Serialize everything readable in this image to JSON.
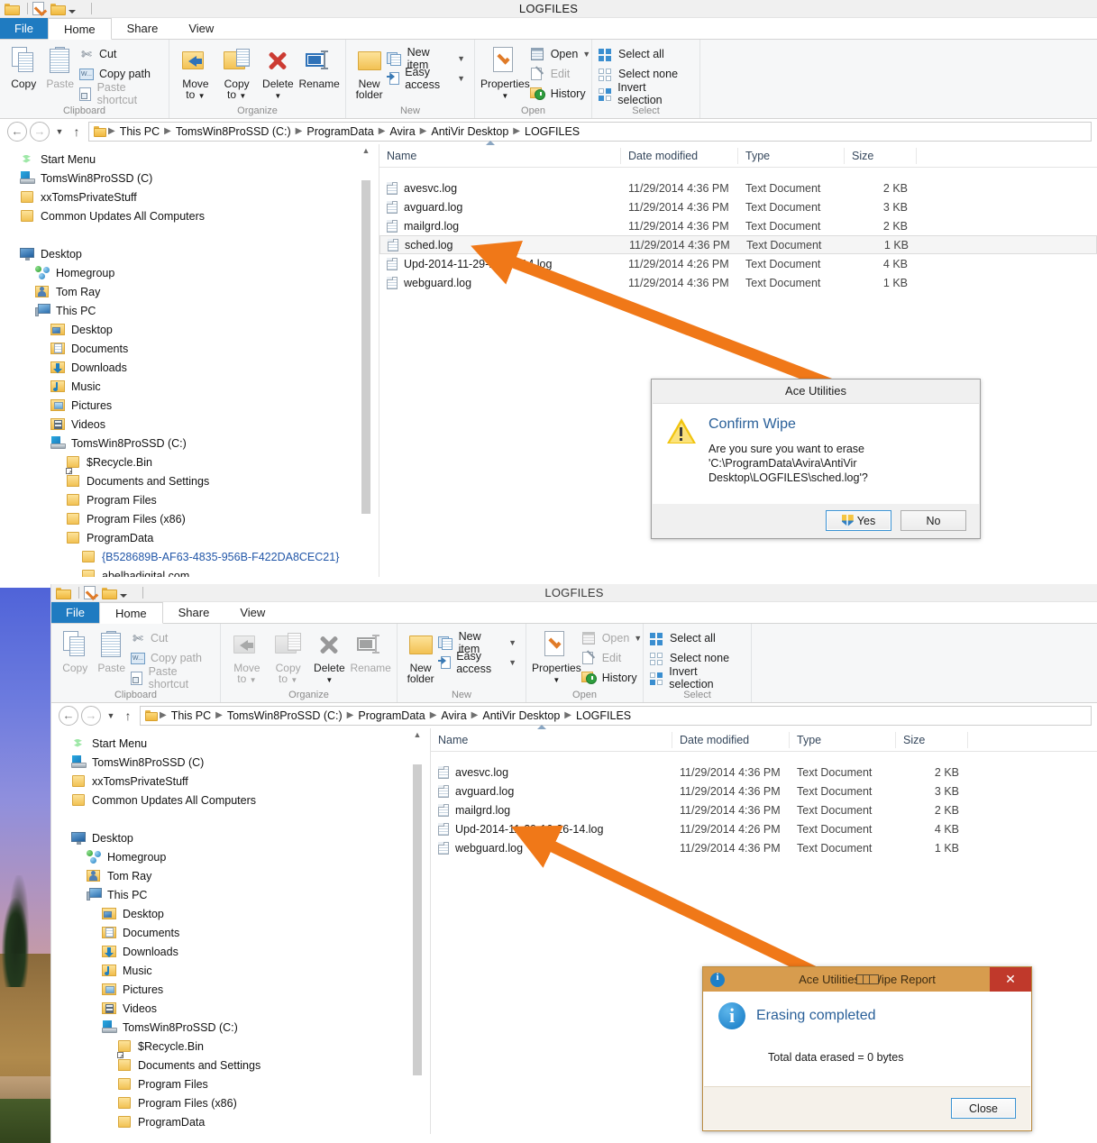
{
  "colors": {
    "accent_orange": "#F07818",
    "file_tab_blue": "#1F7BC1",
    "link_blue": "#2257A8",
    "dialog_title_blue": "#2A6099",
    "wipe_title_bar": "#D79C4E"
  },
  "window1": {
    "title": "LOGFILES",
    "tabs": [
      {
        "label": "File"
      },
      {
        "label": "Home"
      },
      {
        "label": "Share"
      },
      {
        "label": "View"
      }
    ],
    "ribbon": {
      "groups": [
        {
          "label": "Clipboard",
          "big": [
            {
              "label": "Copy",
              "icon": "copy-icon",
              "dim": false
            },
            {
              "label": "Paste",
              "icon": "paste-icon",
              "dim": true
            }
          ],
          "small": [
            {
              "label": "Cut",
              "icon": "scissors-icon",
              "dim": false
            },
            {
              "label": "Copy path",
              "icon": "copy-path-icon",
              "dim": false
            },
            {
              "label": "Paste shortcut",
              "icon": "paste-shortcut-icon",
              "dim": true
            }
          ]
        },
        {
          "label": "Organize",
          "big": [
            {
              "label": "Move to",
              "icon": "move-to-icon",
              "dim": false
            },
            {
              "label": "Copy to",
              "icon": "copy-to-icon",
              "dim": false
            },
            {
              "label": "Delete",
              "icon": "delete-icon",
              "dim": false
            },
            {
              "label": "Rename",
              "icon": "rename-icon",
              "dim": false
            }
          ],
          "small": []
        },
        {
          "label": "New",
          "big": [
            {
              "label": "New folder",
              "icon": "new-folder-icon",
              "dim": false
            }
          ],
          "small": [
            {
              "label": "New item",
              "icon": "new-item-icon",
              "dim": false,
              "dropdown": true
            },
            {
              "label": "Easy access",
              "icon": "easy-access-icon",
              "dim": false,
              "dropdown": true
            }
          ]
        },
        {
          "label": "Open",
          "big": [
            {
              "label": "Properties",
              "icon": "properties-icon",
              "dim": false
            }
          ],
          "small": [
            {
              "label": "Open",
              "icon": "open-icon",
              "dim": false,
              "dropdown": true
            },
            {
              "label": "Edit",
              "icon": "edit-icon",
              "dim": true
            },
            {
              "label": "History",
              "icon": "history-icon",
              "dim": false
            }
          ]
        },
        {
          "label": "Select",
          "big": [],
          "small": [
            {
              "label": "Select all",
              "icon": "select-all-icon",
              "dim": false
            },
            {
              "label": "Select none",
              "icon": "select-none-icon",
              "dim": false
            },
            {
              "label": "Invert selection",
              "icon": "invert-selection-icon",
              "dim": false
            }
          ]
        }
      ]
    },
    "breadcrumb": [
      "This PC",
      "TomsWin8ProSSD (C:)",
      "ProgramData",
      "Avira",
      "AntiVir Desktop",
      "LOGFILES"
    ],
    "nav_tree": [
      {
        "label": "Start Menu",
        "icon": "start-menu-icon",
        "indent": 0,
        "blue": false
      },
      {
        "label": "TomsWin8ProSSD (C)",
        "icon": "drive-icon",
        "indent": 0,
        "blue": false
      },
      {
        "label": "xxTomsPrivateStuff",
        "icon": "folder-icon",
        "indent": 0,
        "blue": false
      },
      {
        "label": "Common Updates All Computers",
        "icon": "folder-icon",
        "indent": 0,
        "blue": false
      },
      {
        "label": "",
        "icon": "spacer",
        "indent": 0,
        "blue": false
      },
      {
        "label": "Desktop",
        "icon": "desktop-icon",
        "indent": 0,
        "blue": false
      },
      {
        "label": "Homegroup",
        "icon": "homegroup-icon",
        "indent": 1,
        "blue": false
      },
      {
        "label": "Tom Ray",
        "icon": "user-folder-icon",
        "indent": 1,
        "blue": false
      },
      {
        "label": "This PC",
        "icon": "this-pc-icon",
        "indent": 1,
        "blue": false
      },
      {
        "label": "Desktop",
        "icon": "desktop-folder-icon",
        "indent": 2,
        "blue": false
      },
      {
        "label": "Documents",
        "icon": "documents-icon",
        "indent": 2,
        "blue": false
      },
      {
        "label": "Downloads",
        "icon": "downloads-icon",
        "indent": 2,
        "blue": false
      },
      {
        "label": "Music",
        "icon": "music-icon",
        "indent": 2,
        "blue": false
      },
      {
        "label": "Pictures",
        "icon": "pictures-icon",
        "indent": 2,
        "blue": false
      },
      {
        "label": "Videos",
        "icon": "videos-icon",
        "indent": 2,
        "blue": false
      },
      {
        "label": "TomsWin8ProSSD (C:)",
        "icon": "drive-icon",
        "indent": 2,
        "blue": false
      },
      {
        "label": "$Recycle.Bin",
        "icon": "folder-icon",
        "indent": 3,
        "blue": false
      },
      {
        "label": "Documents and Settings",
        "icon": "folder-link-icon",
        "indent": 3,
        "blue": false
      },
      {
        "label": "Program Files",
        "icon": "folder-icon",
        "indent": 3,
        "blue": false
      },
      {
        "label": "Program Files (x86)",
        "icon": "folder-icon",
        "indent": 3,
        "blue": false
      },
      {
        "label": "ProgramData",
        "icon": "folder-icon",
        "indent": 3,
        "blue": false
      },
      {
        "label": "{B528689B-AF63-4835-956B-F422DA8CEC21}",
        "icon": "folder-icon",
        "indent": 4,
        "blue": true
      },
      {
        "label": "abelhadigital.com",
        "icon": "folder-icon",
        "indent": 4,
        "blue": false
      }
    ],
    "columns": [
      "Name",
      "Date modified",
      "Type",
      "Size"
    ],
    "files": [
      {
        "name": "avesvc.log",
        "date": "11/29/2014 4:36 PM",
        "type": "Text Document",
        "size": "2 KB",
        "selected": false
      },
      {
        "name": "avguard.log",
        "date": "11/29/2014 4:36 PM",
        "type": "Text Document",
        "size": "3 KB",
        "selected": false
      },
      {
        "name": "mailgrd.log",
        "date": "11/29/2014 4:36 PM",
        "type": "Text Document",
        "size": "2 KB",
        "selected": false
      },
      {
        "name": "sched.log",
        "date": "11/29/2014 4:36 PM",
        "type": "Text Document",
        "size": "1 KB",
        "selected": true
      },
      {
        "name": "Upd-2014-11-29-16-26-14.log",
        "date": "11/29/2014 4:26 PM",
        "type": "Text Document",
        "size": "4 KB",
        "selected": false
      },
      {
        "name": "webguard.log",
        "date": "11/29/2014 4:36 PM",
        "type": "Text Document",
        "size": "1 KB",
        "selected": false
      }
    ]
  },
  "window2": {
    "title": "LOGFILES",
    "tabs": [
      {
        "label": "File"
      },
      {
        "label": "Home"
      },
      {
        "label": "Share"
      },
      {
        "label": "View"
      }
    ],
    "breadcrumb": [
      "This PC",
      "TomsWin8ProSSD (C:)",
      "ProgramData",
      "Avira",
      "AntiVir Desktop",
      "LOGFILES"
    ],
    "nav_tree": [
      {
        "label": "Start Menu",
        "icon": "start-menu-icon",
        "indent": 0,
        "blue": false
      },
      {
        "label": "TomsWin8ProSSD (C)",
        "icon": "drive-icon",
        "indent": 0,
        "blue": false
      },
      {
        "label": "xxTomsPrivateStuff",
        "icon": "folder-icon",
        "indent": 0,
        "blue": false
      },
      {
        "label": "Common Updates All Computers",
        "icon": "folder-icon",
        "indent": 0,
        "blue": false
      },
      {
        "label": "",
        "icon": "spacer",
        "indent": 0,
        "blue": false
      },
      {
        "label": "Desktop",
        "icon": "desktop-icon",
        "indent": 0,
        "blue": false
      },
      {
        "label": "Homegroup",
        "icon": "homegroup-icon",
        "indent": 1,
        "blue": false
      },
      {
        "label": "Tom Ray",
        "icon": "user-folder-icon",
        "indent": 1,
        "blue": false
      },
      {
        "label": "This PC",
        "icon": "this-pc-icon",
        "indent": 1,
        "blue": false
      },
      {
        "label": "Desktop",
        "icon": "desktop-folder-icon",
        "indent": 2,
        "blue": false
      },
      {
        "label": "Documents",
        "icon": "documents-icon",
        "indent": 2,
        "blue": false
      },
      {
        "label": "Downloads",
        "icon": "downloads-icon",
        "indent": 2,
        "blue": false
      },
      {
        "label": "Music",
        "icon": "music-icon",
        "indent": 2,
        "blue": false
      },
      {
        "label": "Pictures",
        "icon": "pictures-icon",
        "indent": 2,
        "blue": false
      },
      {
        "label": "Videos",
        "icon": "videos-icon",
        "indent": 2,
        "blue": false
      },
      {
        "label": "TomsWin8ProSSD (C:)",
        "icon": "drive-icon",
        "indent": 2,
        "blue": false
      },
      {
        "label": "$Recycle.Bin",
        "icon": "folder-icon",
        "indent": 3,
        "blue": false
      },
      {
        "label": "Documents and Settings",
        "icon": "folder-link-icon",
        "indent": 3,
        "blue": false
      },
      {
        "label": "Program Files",
        "icon": "folder-icon",
        "indent": 3,
        "blue": false
      },
      {
        "label": "Program Files (x86)",
        "icon": "folder-icon",
        "indent": 3,
        "blue": false
      },
      {
        "label": "ProgramData",
        "icon": "folder-icon",
        "indent": 3,
        "blue": false
      }
    ],
    "columns": [
      "Name",
      "Date modified",
      "Type",
      "Size"
    ],
    "files": [
      {
        "name": "avesvc.log",
        "date": "11/29/2014 4:36 PM",
        "type": "Text Document",
        "size": "2 KB",
        "selected": false
      },
      {
        "name": "avguard.log",
        "date": "11/29/2014 4:36 PM",
        "type": "Text Document",
        "size": "3 KB",
        "selected": false
      },
      {
        "name": "mailgrd.log",
        "date": "11/29/2014 4:36 PM",
        "type": "Text Document",
        "size": "2 KB",
        "selected": false
      },
      {
        "name": "Upd-2014-11-29-16-26-14.log",
        "date": "11/29/2014 4:26 PM",
        "type": "Text Document",
        "size": "4 KB",
        "selected": false
      },
      {
        "name": "webguard.log",
        "date": "11/29/2014 4:36 PM",
        "type": "Text Document",
        "size": "1 KB",
        "selected": false
      }
    ]
  },
  "confirm_dialog": {
    "title": "Ace Utilities",
    "heading": "Confirm Wipe",
    "message": "Are you sure you want to erase 'C:\\ProgramData\\Avira\\AntiVir Desktop\\LOGFILES\\sched.log'?",
    "yes_label": "Yes",
    "no_label": "No"
  },
  "report_dialog": {
    "title": "Ace Utilities - Wipe Report",
    "heading": "Erasing completed",
    "message": "Total data erased  =  0 bytes",
    "close_label": "Close",
    "close_x": "✕"
  }
}
